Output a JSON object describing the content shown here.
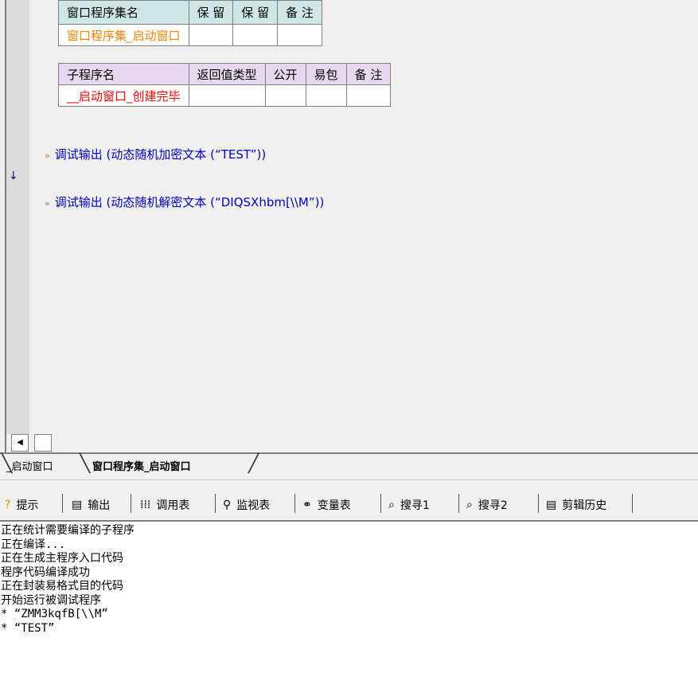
{
  "editor": {
    "window_table": {
      "headers": [
        "窗口程序集名",
        "保 留",
        "保 留",
        "备 注"
      ],
      "values": [
        "窗口程序集_启动窗口",
        "",
        "",
        ""
      ]
    },
    "sub_table": {
      "headers": [
        "子程序名",
        "返回值类型",
        "公开",
        "易包",
        "备 注"
      ],
      "values": [
        "__启动窗口_创建完毕",
        "",
        "",
        "",
        ""
      ]
    },
    "code_lines": [
      "调试输出 (动态随机加密文本 (“TEST”))",
      "调试输出 (动态随机解密文本 (“DIQSXhbm[\\\\M”))"
    ],
    "gutter_arrow": "↓"
  },
  "file_tabs": [
    "_启动窗口",
    "窗口程序集_启动窗口"
  ],
  "tool_tabs": [
    {
      "label": "提示",
      "icon": "tip-icon"
    },
    {
      "label": "输出",
      "icon": "output-icon"
    },
    {
      "label": "调用表",
      "icon": "call-table-icon"
    },
    {
      "label": "监视表",
      "icon": "watch-icon"
    },
    {
      "label": "变量表",
      "icon": "variable-icon"
    },
    {
      "label": "搜寻1",
      "icon": "search1-icon"
    },
    {
      "label": "搜寻2",
      "icon": "search2-icon"
    },
    {
      "label": "剪辑历史",
      "icon": "clipboard-history-icon"
    }
  ],
  "output_lines": [
    "正在统计需要编译的子程序",
    "正在编译...",
    "正在生成主程序入口代码",
    "程序代码编译成功",
    "正在封装易格式目的代码",
    "开始运行被调试程序",
    "* “ZMM3kqfB[\\\\M”",
    "* “TEST”"
  ]
}
